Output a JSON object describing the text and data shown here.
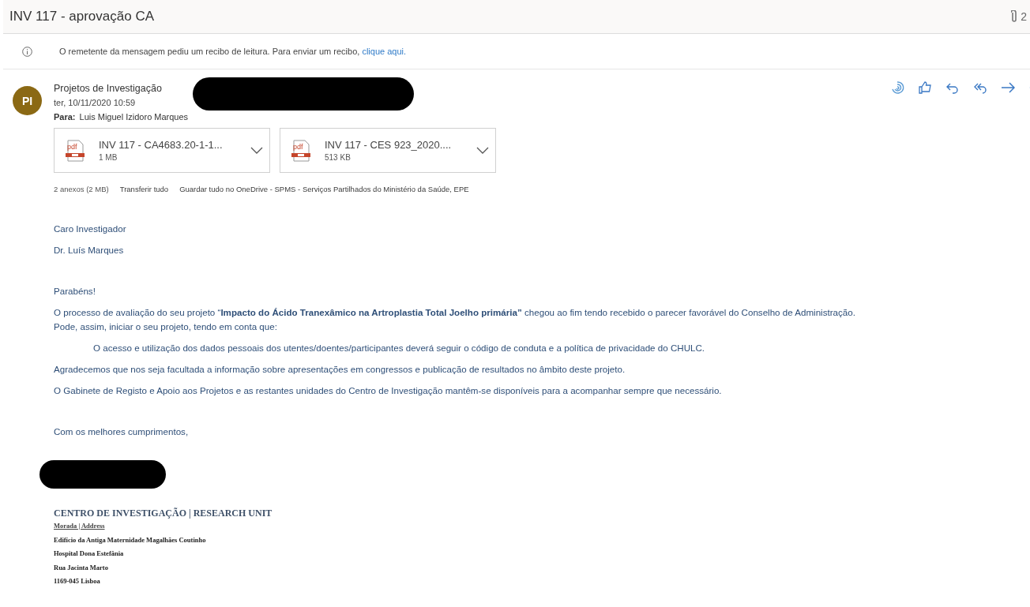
{
  "subject": "INV 117 - aprovação CA",
  "attachment_count": "2",
  "read_receipt": {
    "text": "O remetente da mensagem pediu um recibo de leitura. Para enviar um recibo,",
    "link": "clique aqui."
  },
  "sender": {
    "initials": "PI",
    "name": "Projetos de Investigação",
    "date": "ter, 10/11/2020 10:59",
    "to_label": "Para:",
    "to": "Luis Miguel Izidoro Marques"
  },
  "attachments": [
    {
      "name": "INV 117 - CA4683.20-1-1...",
      "size": "1 MB",
      "type_label": "pdf"
    },
    {
      "name": "INV 117 - CES 923_2020....",
      "size": "513 KB",
      "type_label": "pdf"
    }
  ],
  "attachment_actions": [
    {
      "kind": "summary",
      "label": "2 anexos (2 MB)"
    },
    {
      "kind": "link",
      "label": "Transferir tudo"
    },
    {
      "kind": "link",
      "label": "Guardar tudo no OneDrive - SPMS - Serviços Partilhados do Ministério da Saúde, EPE"
    }
  ],
  "body": [
    {
      "kind": "line",
      "spaced": false,
      "lines": [
        "Caro Investigador"
      ]
    },
    {
      "kind": "line",
      "spaced": false,
      "lines": [
        "Dr. Luís Marques"
      ]
    },
    {
      "kind": "line",
      "spaced": true,
      "lines": [
        "Parabéns!"
      ]
    },
    {
      "kind": "line",
      "spaced": false,
      "lines": [
        "O processo de avaliação do seu projeto “**Impacto do Ácido Tranexâmico na Artroplastia Total Joelho primária”** chegou ao fim tendo recebido o parecer favorável do Conselho de Administração.",
        "Pode, assim, iniciar o seu projeto, tendo em conta que:"
      ]
    },
    {
      "kind": "indented",
      "spaced": false,
      "lines": [
        "O acesso e utilização dos dados pessoais dos utentes/doentes/participantes deverá seguir o código de conduta e a política de privacidade do CHULC."
      ]
    },
    {
      "kind": "line",
      "spaced": false,
      "lines": [
        "Agradecemos que nos seja facultada a informação sobre apresentações em congressos e publicação de resultados no âmbito deste projeto."
      ]
    },
    {
      "kind": "line",
      "spaced": false,
      "lines": [
        "O Gabinete de Registo e Apoio aos Projetos e as restantes unidades do Centro de Investigação mantêm-se disponíveis para a acompanhar sempre que necessário."
      ]
    },
    {
      "kind": "line",
      "spaced": true,
      "lines": [
        "Com os melhores cumprimentos,"
      ]
    }
  ],
  "signature": {
    "heading": "CENTRO DE INVESTIGAÇÃO | RESEARCH UNIT",
    "address_label": "Morada | Address",
    "lines": [
      "Edifício da Antiga Maternidade Magalhães Coutinho",
      "Hospital Dona Estefânia",
      "Rua Jacinta Marto",
      "1169-045 Lisboa"
    ]
  }
}
